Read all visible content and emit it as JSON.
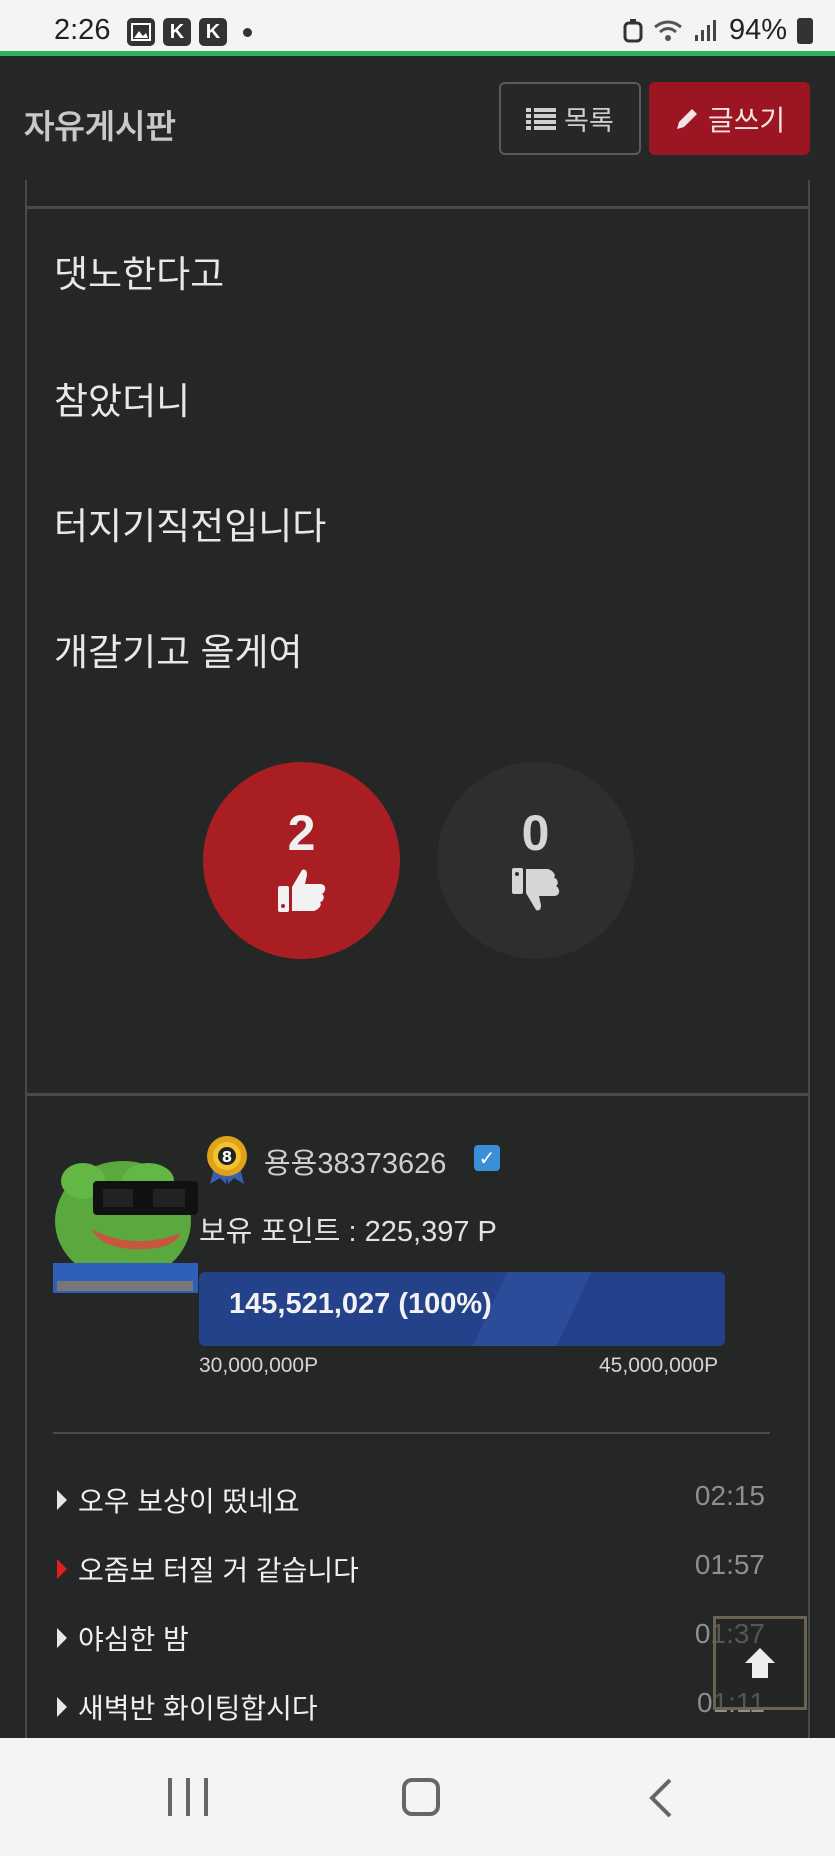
{
  "status_bar": {
    "time": "2:26",
    "battery": "94%",
    "notif_icons": [
      "image-icon",
      "kakao-k-icon",
      "kakao-k-icon"
    ]
  },
  "header": {
    "title": "자유게시판",
    "list_label": "목록",
    "write_label": "글쓰기"
  },
  "post": {
    "lines": [
      "댓노한다고",
      "참았더니",
      "터지기직전입니다",
      "개갈기고 올게여"
    ],
    "upvotes": "2",
    "downvotes": "0"
  },
  "author": {
    "level": "8",
    "nickname": "용용38373626",
    "verified": true,
    "points_label": "보유 포인트 : 225,397 P",
    "progress_text": "145,521,027 (100%)",
    "progress_fraction": 1.0,
    "range_min": "30,000,000P",
    "range_max": "45,000,000P"
  },
  "related_posts": [
    {
      "title": "오우 보상이 떴네요",
      "time": "02:15",
      "highlight": false
    },
    {
      "title": "오줌보 터질 거 같습니다",
      "time": "01:57",
      "highlight": true
    },
    {
      "title": "야심한 밤",
      "time": "01:37",
      "highlight": false
    },
    {
      "title": "새벽반 화이팅합시다",
      "time": "01:11",
      "highlight": false
    }
  ],
  "colors": {
    "accent_red": "#9b1622",
    "vote_red": "#a81e22",
    "progress_blue": "#24428a",
    "background": "#252626"
  }
}
